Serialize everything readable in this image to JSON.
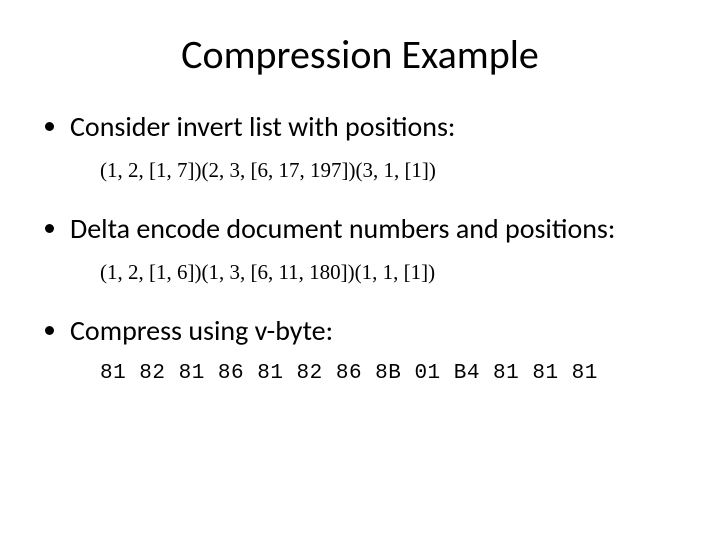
{
  "title": "Compression Example",
  "bullets": {
    "b1": "Consider invert list with positions:",
    "b2": "Delta encode document numbers and positions:",
    "b3": "Compress using v-byte:"
  },
  "formulas": {
    "f1": "(1, 2, [1, 7])(2, 3, [6, 17, 197])(3, 1, [1])",
    "f2": "(1, 2, [1, 6])(1, 3, [6, 11, 180])(1, 1, [1])"
  },
  "vbyte": "81 82 81 86 81 82 86 8B 01 B4 81 81 81"
}
